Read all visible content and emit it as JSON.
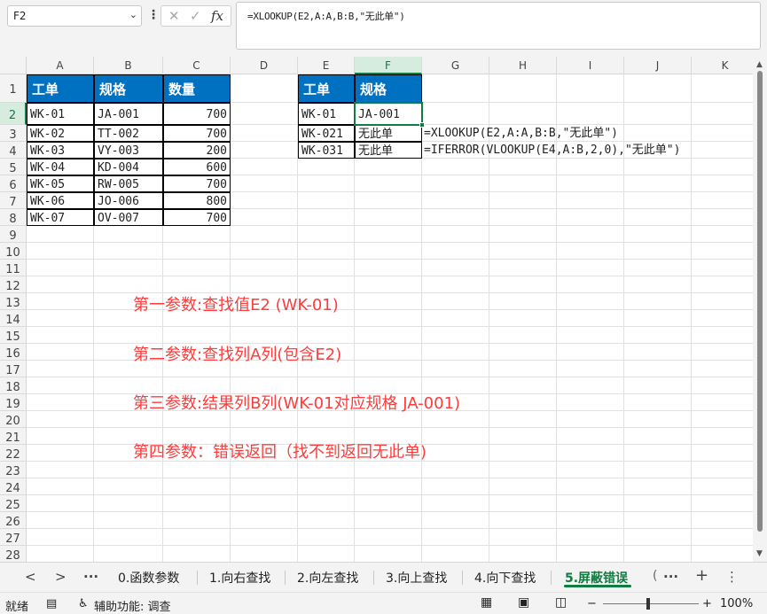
{
  "formula_bar": {
    "name_box": "F2",
    "formula": "=XLOOKUP(E2,A:A,B:B,\"无此单\")",
    "cancel_glyph": "✕",
    "enter_glyph": "✓",
    "fx_glyph": "fx"
  },
  "columns": [
    "A",
    "B",
    "C",
    "D",
    "E",
    "F",
    "G",
    "H",
    "I",
    "J",
    "K"
  ],
  "rows": [
    "1",
    "2",
    "3",
    "4",
    "5",
    "6",
    "7",
    "8",
    "9",
    "10",
    "11",
    "12",
    "13",
    "14",
    "15",
    "16",
    "17",
    "18",
    "19",
    "20",
    "21",
    "22",
    "23",
    "24",
    "25",
    "26",
    "27",
    "28"
  ],
  "table1": {
    "headers": [
      "工单",
      "规格",
      "数量"
    ],
    "rows": [
      [
        "WK-01",
        "JA-001",
        "700"
      ],
      [
        "WK-02",
        "TT-002",
        "700"
      ],
      [
        "WK-03",
        "VY-003",
        "200"
      ],
      [
        "WK-04",
        "KD-004",
        "600"
      ],
      [
        "WK-05",
        "RW-005",
        "700"
      ],
      [
        "WK-06",
        "JO-006",
        "800"
      ],
      [
        "WK-07",
        "OV-007",
        "700"
      ]
    ]
  },
  "table2": {
    "headers": [
      "工单",
      "规格"
    ],
    "rows": [
      [
        "WK-01",
        "JA-001"
      ],
      [
        "WK-021",
        "无此单"
      ],
      [
        "WK-031",
        "无此单"
      ]
    ]
  },
  "formula_notes": [
    "=XLOOKUP(E2,A:A,B:B,\"无此单\")",
    "=IFERROR(VLOOKUP(E4,A:B,2,0),\"无此单\")"
  ],
  "annotations": [
    "第一参数:查找值E2 (WK-01)",
    "第二参数:查找列A列(包含E2)",
    "第三参数:结果列B列(WK-01对应规格 JA-001)",
    "第四参数：错误返回（找不到返回无此单)"
  ],
  "sheet_tabs": {
    "prev": "<",
    "next": ">",
    "more_left": "···",
    "tabs": [
      "0.函数参数",
      "1.向右查找",
      "2.向左查找",
      "3.向上查找",
      "4.向下查找",
      "5.屏蔽错误"
    ],
    "partial_tab": "(",
    "more_right": "···",
    "add": "+",
    "menu": "⋮",
    "active_index": 5
  },
  "status_bar": {
    "ready": "就绪",
    "accessibility": "辅助功能: 调查",
    "zoom_minus": "−",
    "zoom_plus": "+",
    "zoom": "100%",
    "zoom_level_percent": 100
  },
  "colors": {
    "header_fill": "#0070c0",
    "annotation_text": "#ff3b3b",
    "excel_green": "#107c41"
  }
}
